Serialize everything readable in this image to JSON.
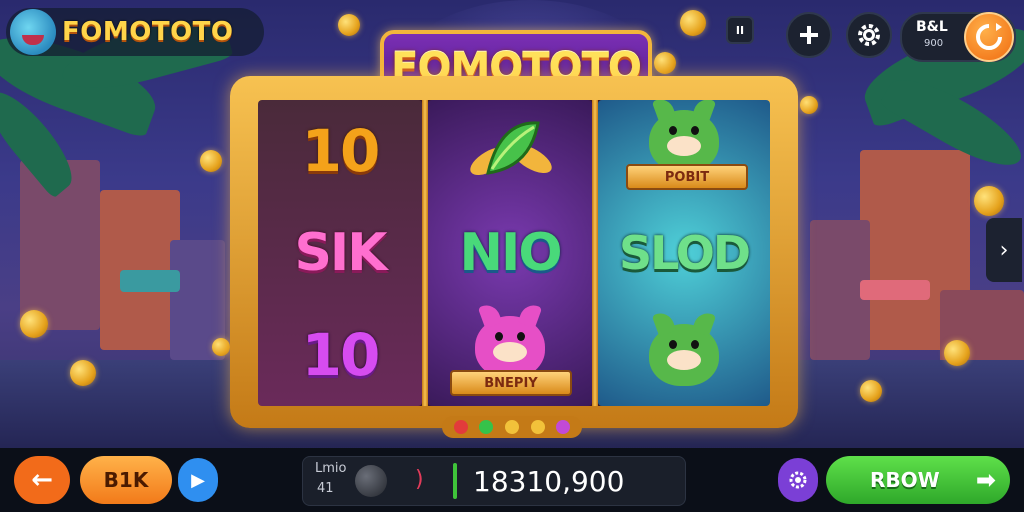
{
  "header": {
    "logo_text": "FOMOTOTO",
    "title_text": "FOMOTOTO",
    "pause_icon_label": "II",
    "balance_label": "B&L",
    "balance_value": "900"
  },
  "reels": [
    {
      "top": {
        "text": "10",
        "color": "#f4a21a"
      },
      "middle": {
        "text": "SIK",
        "color": "#ff6fcf"
      },
      "bottom": {
        "text": "10",
        "color": "#d64cf0"
      }
    },
    {
      "top": {
        "icon": "leaf-gem-icon"
      },
      "middle": {
        "text": "NIO",
        "color": "#49d97a"
      },
      "bottom": {
        "banner": "BNEPIY",
        "mascot_color": "#e64fc6"
      }
    },
    {
      "top": {
        "banner": "POBIT",
        "mascot_color": "#57b84a"
      },
      "middle": {
        "text": "SLOD",
        "color": "#6fe08a"
      },
      "bottom": {
        "mascot_color": "#57b84a"
      }
    }
  ],
  "gems": [
    "#e23b3b",
    "#36c24a",
    "#f2c23a",
    "#f2c23a",
    "#c24ad6"
  ],
  "controls": {
    "back_label": "←",
    "bet_label": "B1K",
    "play_label": "▶",
    "readout_small_top": "Lmio",
    "readout_small_bottom": "41",
    "readout_paren": ")",
    "readout_value": "18310,900",
    "spin_label": "RBOW",
    "spin_arrow": "➡"
  },
  "colors": {
    "accent_gold": "#f7c251",
    "orange": "#f26b1a",
    "green": "#3fc43a",
    "blue": "#2f8ff0",
    "purple": "#7b3fd6"
  }
}
